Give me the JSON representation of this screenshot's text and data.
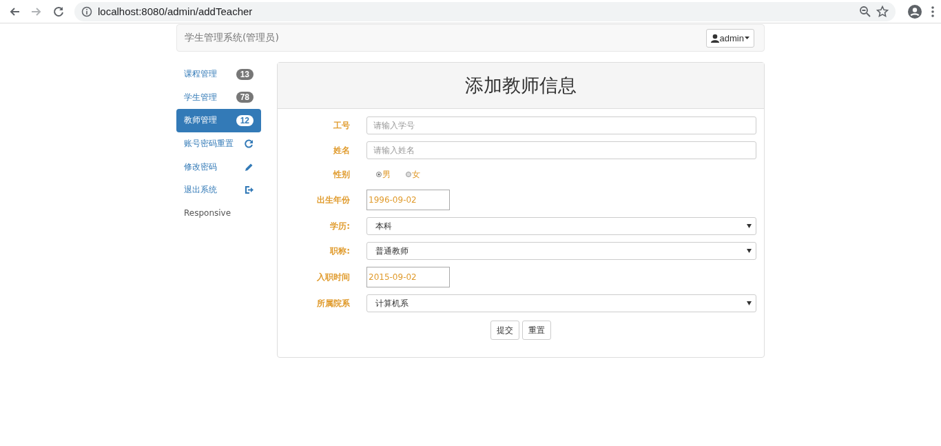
{
  "browser": {
    "url": "localhost:8080/admin/addTeacher"
  },
  "navbar": {
    "brand": "学生管理系统(管理员)",
    "user_menu": "admin"
  },
  "sidebar": {
    "items": [
      {
        "label": "课程管理",
        "kind": "badge",
        "badge": "13",
        "selected": false
      },
      {
        "label": "学生管理",
        "kind": "badge",
        "badge": "78",
        "selected": false
      },
      {
        "label": "教师管理",
        "kind": "badge",
        "badge": "12",
        "selected": true
      },
      {
        "label": "账号密码重置",
        "kind": "icon",
        "selected": false
      },
      {
        "label": "修改密码",
        "kind": "icon",
        "selected": false
      },
      {
        "label": "退出系统",
        "kind": "icon",
        "selected": false
      },
      {
        "label": "Responsive",
        "kind": "text",
        "selected": false
      }
    ]
  },
  "form": {
    "title": "添加教师信息",
    "fields": [
      {
        "label": "工号",
        "kind": "text",
        "placeholder": "请输入学号"
      },
      {
        "label": "姓名",
        "kind": "text",
        "placeholder": "请输入姓名"
      },
      {
        "label": "性别",
        "kind": "radio",
        "options": [
          {
            "label": "男",
            "selected": true
          },
          {
            "label": "女",
            "selected": false
          }
        ]
      },
      {
        "label": "出生年份",
        "kind": "date",
        "value": "1996-09-02"
      },
      {
        "label": "学历:",
        "kind": "select",
        "value": "本科"
      },
      {
        "label": "职称:",
        "kind": "select",
        "value": "普通教师"
      },
      {
        "label": "入职时间",
        "kind": "date",
        "value": "2015-09-02"
      },
      {
        "label": "所属院系",
        "kind": "select",
        "value": "计算机系"
      }
    ],
    "buttons": [
      "提交",
      "重置"
    ]
  }
}
